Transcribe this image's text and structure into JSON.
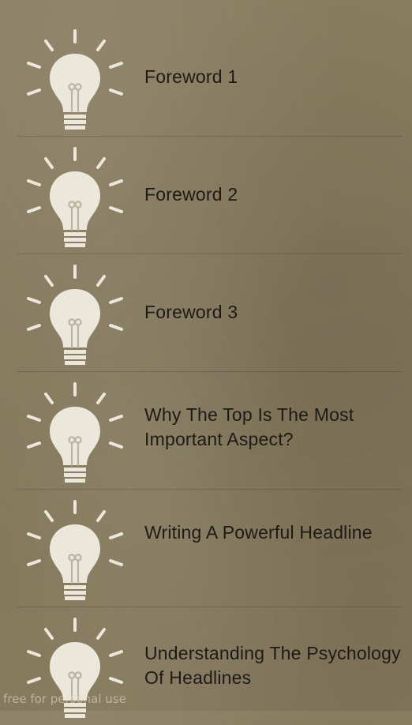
{
  "items": [
    {
      "title": "Foreword 1",
      "icon": "lightbulb-icon"
    },
    {
      "title": "Foreword 2",
      "icon": "lightbulb-icon"
    },
    {
      "title": "Foreword 3",
      "icon": "lightbulb-icon"
    },
    {
      "title": "Why The Top Is The Most Important Aspect?",
      "icon": "lightbulb-icon"
    },
    {
      "title": "Writing A Powerful Headline",
      "icon": "lightbulb-icon"
    },
    {
      "title": "Understanding The Psychology Of Headlines",
      "icon": "lightbulb-icon"
    }
  ],
  "watermark": "free for personal use",
  "colors": {
    "background": "#857a5f",
    "text": "#1e1b16",
    "icon": "#ece7db"
  }
}
